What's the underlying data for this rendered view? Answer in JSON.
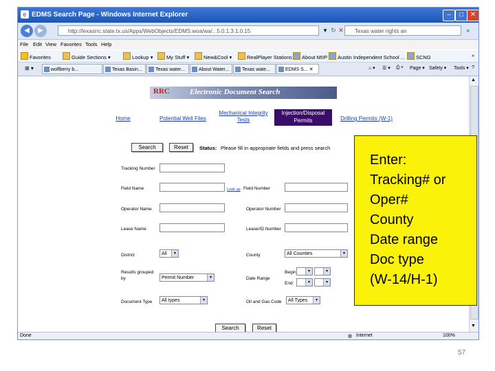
{
  "window": {
    "title": "EDMS Search Page - Windows Internet Explorer",
    "address": "http://lexasrrc.state.tx.us/Apps/WebObjects/EDMS.woa/wa/...5.0.1.3.1.0.15",
    "search_placeholder": "Texas water rights an",
    "menu": [
      "File",
      "Edit",
      "View",
      "Favorites",
      "Tools",
      "Help"
    ],
    "favorites": [
      "Favorites",
      "Guide Sections",
      "Lookup",
      "My Stuff",
      "New&Cool",
      "RealPlayer Stations",
      "About MIIP",
      "Austin Independent School ...",
      "SCNG"
    ],
    "tabs": [
      "wolfberry b...",
      "Texas Basin...",
      "Texas water...",
      "About Water...",
      "Texas wate...",
      "EDMS S..."
    ],
    "tools": [
      "Page",
      "Safety",
      "Tools"
    ],
    "status_left": "Done",
    "status_zone": "Internet",
    "zoom": "100%"
  },
  "page": {
    "banner_title": "Electronic Document Search",
    "banner_logo": "RRC",
    "nav": [
      "Home",
      "Potential Well Files",
      "Mechanical Integrity Tests",
      "Injection/Disposal Permits",
      "Drilling Permits (W-1)"
    ],
    "search_label": "Search",
    "reset_label": "Reset",
    "status_label": "Status:",
    "status_text": "Please fill in appropriate fields and press search",
    "fields": {
      "tracking": "Tracking Number",
      "field_name": "Field Name",
      "lookup": "Look up",
      "field_number": "Field Number",
      "operator_name": "Operator Name",
      "operator_number": "Operator Number",
      "lease_name": "Lease Name",
      "lease_id": "Lease/ID Number",
      "district": "District",
      "district_value": "All",
      "county": "County",
      "county_value": "All Counties",
      "results": "Results grouped by",
      "results_value": "Permit Number",
      "date_range": "Date Range",
      "begin": "Begin:",
      "end": "End:",
      "document_type": "Document Type",
      "document_value": "All types",
      "oil_gas": "Oil and Gas Code",
      "oil_gas_value": "All Types"
    }
  },
  "callout": {
    "lines": [
      "Enter:",
      "Tracking# or",
      "Oper#",
      "County",
      "Date range",
      "Doc type",
      "(W-14/H-1)"
    ]
  },
  "slide_number": "57"
}
